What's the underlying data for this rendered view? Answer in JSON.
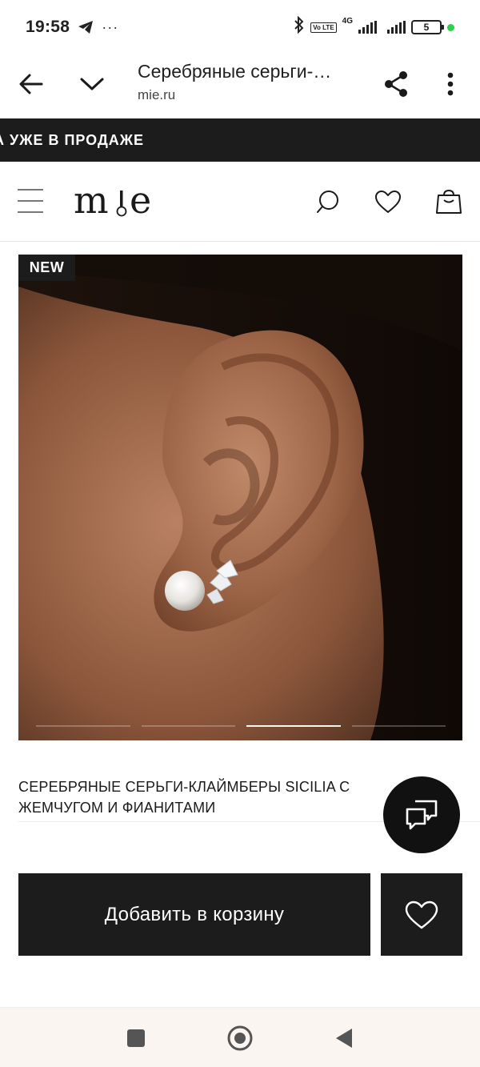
{
  "status_bar": {
    "time": "19:58",
    "dots": "···",
    "network": "4G",
    "volte": "Vo LTE",
    "battery": "5"
  },
  "browser": {
    "title": "Серебряные серьги-…",
    "url": "mie.ru"
  },
  "promo": {
    "text": "А УЖЕ В ПРОДАЖЕ"
  },
  "site": {
    "logo": "mie",
    "menu_icon": "hamburger-icon",
    "search_icon": "search-icon",
    "favorites_icon": "heart-icon",
    "cart_icon": "bag-icon"
  },
  "product": {
    "badge": "NEW",
    "title": "СЕРЕБРЯНЫЕ СЕРЬГИ-КЛАЙМБЕРЫ SICILIA С ЖЕМЧУГОМ И ФИАНИТАМИ",
    "gallery": {
      "slides": 4,
      "active_slide": 3
    }
  },
  "actions": {
    "add_to_cart": "Добавить в корзину"
  },
  "colors": {
    "dark": "#1c1c1c",
    "navbar_bg": "#fbf5f1",
    "battery_dot": "#2bd14a"
  }
}
